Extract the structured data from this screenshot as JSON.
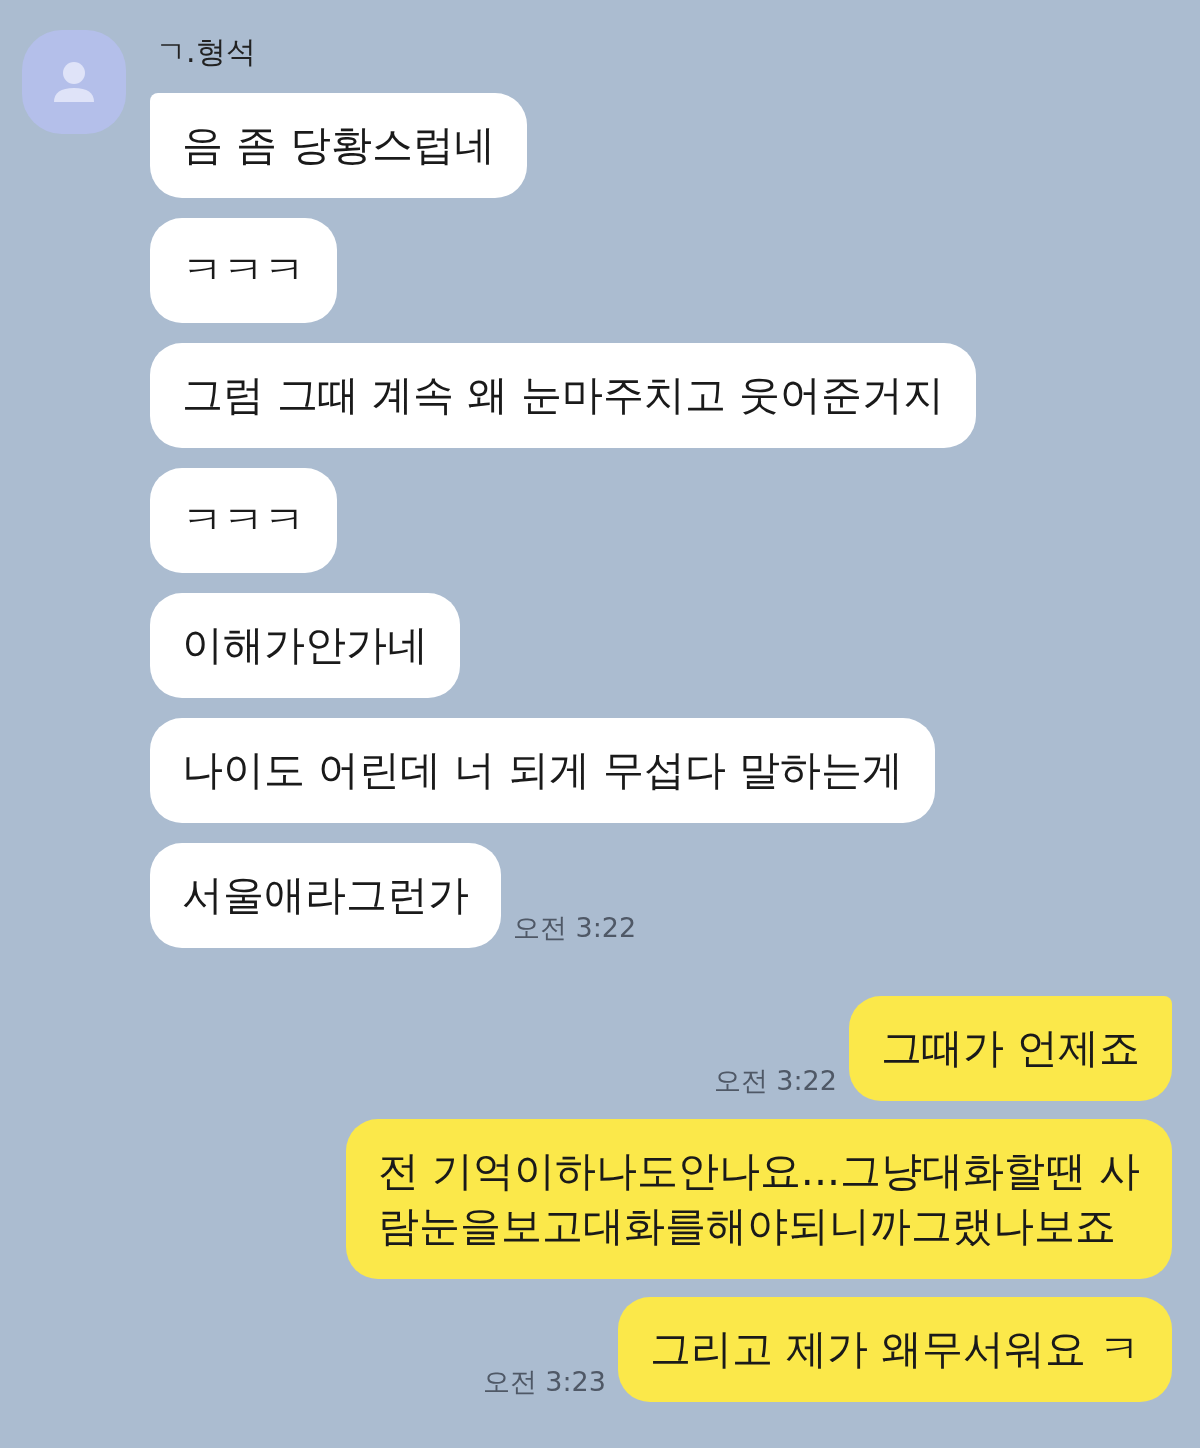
{
  "sender": {
    "name": "ㄱ.형석"
  },
  "messages": [
    {
      "kind": "received",
      "text": "음 좀 당황스럽네",
      "tail": true
    },
    {
      "kind": "received",
      "text": "ㅋㅋㅋ",
      "tail": false
    },
    {
      "kind": "received",
      "text": "그럼 그때 계속 왜 눈마주치고 웃어준거지",
      "tail": false
    },
    {
      "kind": "received",
      "text": "ㅋㅋㅋ",
      "tail": false
    },
    {
      "kind": "received",
      "text": "이해가안가네",
      "tail": false
    },
    {
      "kind": "received",
      "text": "나이도 어린데 너 되게 무섭다 말하는게",
      "tail": false
    },
    {
      "kind": "received",
      "text": "서울애라그런가",
      "tail": false,
      "time": "오전 3:22"
    },
    {
      "kind": "sent",
      "text": "그때가 언제죠",
      "tail": true,
      "time": "오전 3:22"
    },
    {
      "kind": "sent",
      "text": "전 기억이하나도안나요...그냥대화할땐 사\n람눈을보고대화를해야되니까그랬나보죠",
      "tail": false
    },
    {
      "kind": "sent",
      "text": "그리고 제가 왜무서워요 ㅋ",
      "tail": false,
      "time": "오전 3:23"
    }
  ]
}
